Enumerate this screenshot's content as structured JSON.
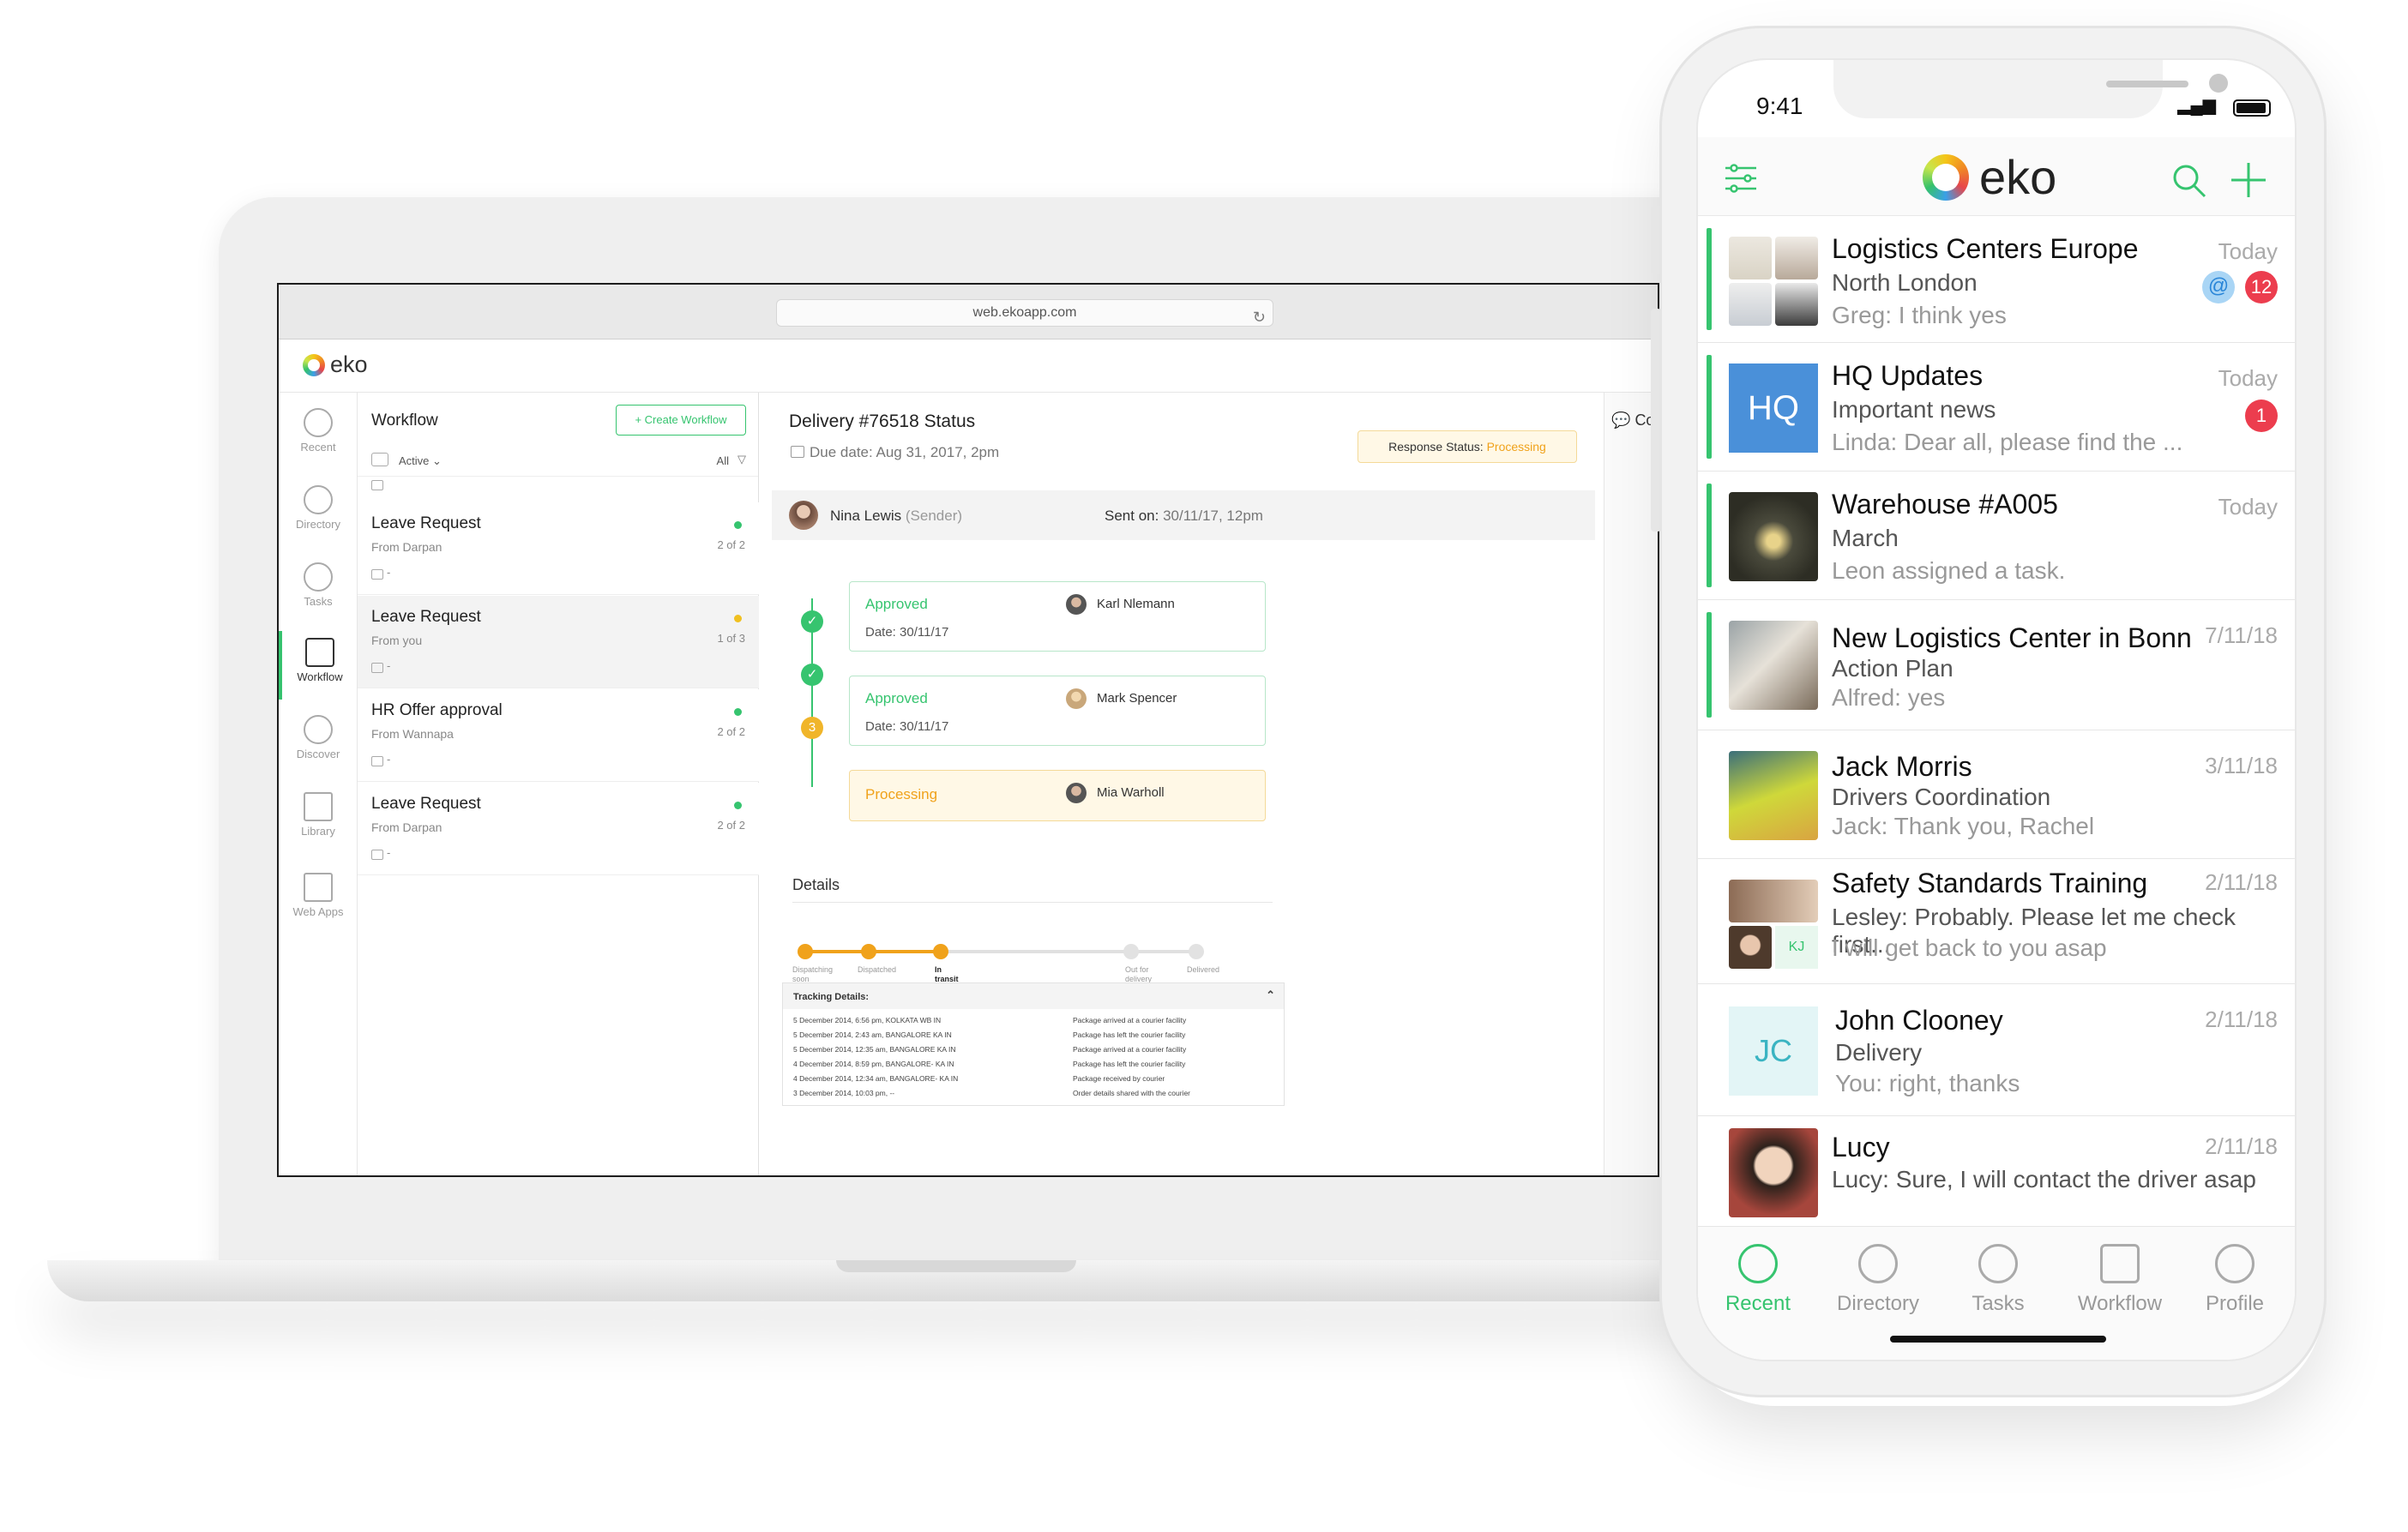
{
  "browser": {
    "url": "web.ekoapp.com"
  },
  "web": {
    "logo_text": "eko",
    "nav": [
      {
        "label": "Recent",
        "icon": "clock-icon"
      },
      {
        "label": "Directory",
        "icon": "people-icon"
      },
      {
        "label": "Tasks",
        "icon": "check-circle-icon"
      },
      {
        "label": "Workflow",
        "icon": "workflow-icon"
      },
      {
        "label": "Discover",
        "icon": "bulb-icon"
      },
      {
        "label": "Library",
        "icon": "books-icon"
      },
      {
        "label": "Web Apps",
        "icon": "window-icon"
      }
    ],
    "workflow": {
      "title": "Workflow",
      "create_button": "+ Create Workflow",
      "filter_active": "Active",
      "filter_all": "All",
      "items": [
        {
          "title": "Leave Request",
          "from": "From Darpan",
          "count": "2 of 2",
          "date": "-",
          "status_color": "#36c46f"
        },
        {
          "title": "Leave Request",
          "from": "From you",
          "count": "1 of 3",
          "date": "-",
          "status_color": "#f0c020"
        },
        {
          "title": "HR Offer approval",
          "from": "From Wannapa",
          "count": "2 of 2",
          "date": "-",
          "status_color": "#36c46f"
        },
        {
          "title": "Leave Request",
          "from": "From Darpan",
          "count": "2 of 2",
          "date": "-",
          "status_color": "#36c46f"
        }
      ]
    },
    "detail": {
      "title": "Delivery #76518 Status",
      "due_date": "Due date: Aug 31, 2017, 2pm",
      "response_status_label": "Response Status:",
      "response_status_value": "Processing",
      "sender_name": "Nina Lewis",
      "sender_role": "(Sender)",
      "sent_on_label": "Sent on:",
      "sent_on_value": "30/11/17, 12pm",
      "steps": [
        {
          "status": "Approved",
          "date": "Date: 30/11/17",
          "person": "Karl Nlemann"
        },
        {
          "status": "Approved",
          "date": "Date: 30/11/17",
          "person": "Mark Spencer"
        },
        {
          "status": "Processing",
          "date": "",
          "person": "Mia Warholl",
          "number": "3"
        }
      ],
      "details_heading": "Details",
      "tracker_steps": [
        {
          "label": "Dispatching soon",
          "done": true
        },
        {
          "label": "Dispatched",
          "done": true
        },
        {
          "label": "In transit",
          "done": true,
          "current": true
        },
        {
          "label": "Out for delivery",
          "done": false
        },
        {
          "label": "Delivered",
          "done": false
        }
      ],
      "tracking_title": "Tracking Details:",
      "tracking_rows": [
        {
          "left": "5 December 2014, 6:56 pm, KOLKATA WB IN",
          "right": "Package arrived at a courier facility"
        },
        {
          "left": "5 December 2014, 2:43 am, BANGALORE KA IN",
          "right": "Package has left the courier facility"
        },
        {
          "left": "5 December 2014, 12:35 am, BANGALORE KA IN",
          "right": "Package arrived at a courier facility"
        },
        {
          "left": "4 December 2014, 8:59 pm, BANGALORE- KA IN",
          "right": "Package has left the courier facility"
        },
        {
          "left": "4 December 2014, 12:34 am, BANGALORE- KA IN",
          "right": "Package received by courier"
        },
        {
          "left": "3 December 2014, 10:03 pm, --",
          "right": "Order details shared with the courier"
        }
      ]
    },
    "side_panel": {
      "label": "Co"
    }
  },
  "phone": {
    "status_time": "9:41",
    "logo_text": "eko",
    "chats": [
      {
        "name": "Logistics Centers Europe",
        "line2": "North London",
        "line3": "Greg: I think yes",
        "time": "Today",
        "unread": "12",
        "mention": "@",
        "active_bar": true
      },
      {
        "name": "HQ Updates",
        "line2": "Important news",
        "line3": "Linda: Dear all, please find the ...",
        "time": "Today",
        "unread": "1",
        "avatar_text": "HQ",
        "active_bar": true
      },
      {
        "name": "Warehouse #A005",
        "line2": "March",
        "line3": "Leon assigned a task.",
        "time": "Today",
        "active_bar": true
      },
      {
        "name": "New Logistics Center in Bonn",
        "line2": "Action Plan",
        "line3": "Alfred: yes",
        "time": "7/11/18",
        "active_bar": true
      },
      {
        "name": "Jack Morris",
        "line2": "Drivers Coordination",
        "line3": "Jack: Thank you, Rachel",
        "time": "3/11/18"
      },
      {
        "name": "Safety Standards Training",
        "line2": "Lesley: Probably. Please let me check first...",
        "line3": "I will get back to you asap",
        "time": "2/11/18",
        "avatar_initials": "KJ"
      },
      {
        "name": "John Clooney",
        "line2": "Delivery",
        "line3": "You: right, thanks",
        "time": "2/11/18",
        "avatar_text": "JC"
      },
      {
        "name": "Lucy",
        "line2": "Lucy: Sure, I will contact the driver asap",
        "line3": "",
        "time": "2/11/18"
      }
    ],
    "tabs": [
      {
        "label": "Recent",
        "icon": "clock-icon",
        "active": true
      },
      {
        "label": "Directory",
        "icon": "people-icon"
      },
      {
        "label": "Tasks",
        "icon": "check-circle-icon"
      },
      {
        "label": "Workflow",
        "icon": "workflow-icon"
      },
      {
        "label": "Profile",
        "icon": "person-icon"
      }
    ]
  }
}
